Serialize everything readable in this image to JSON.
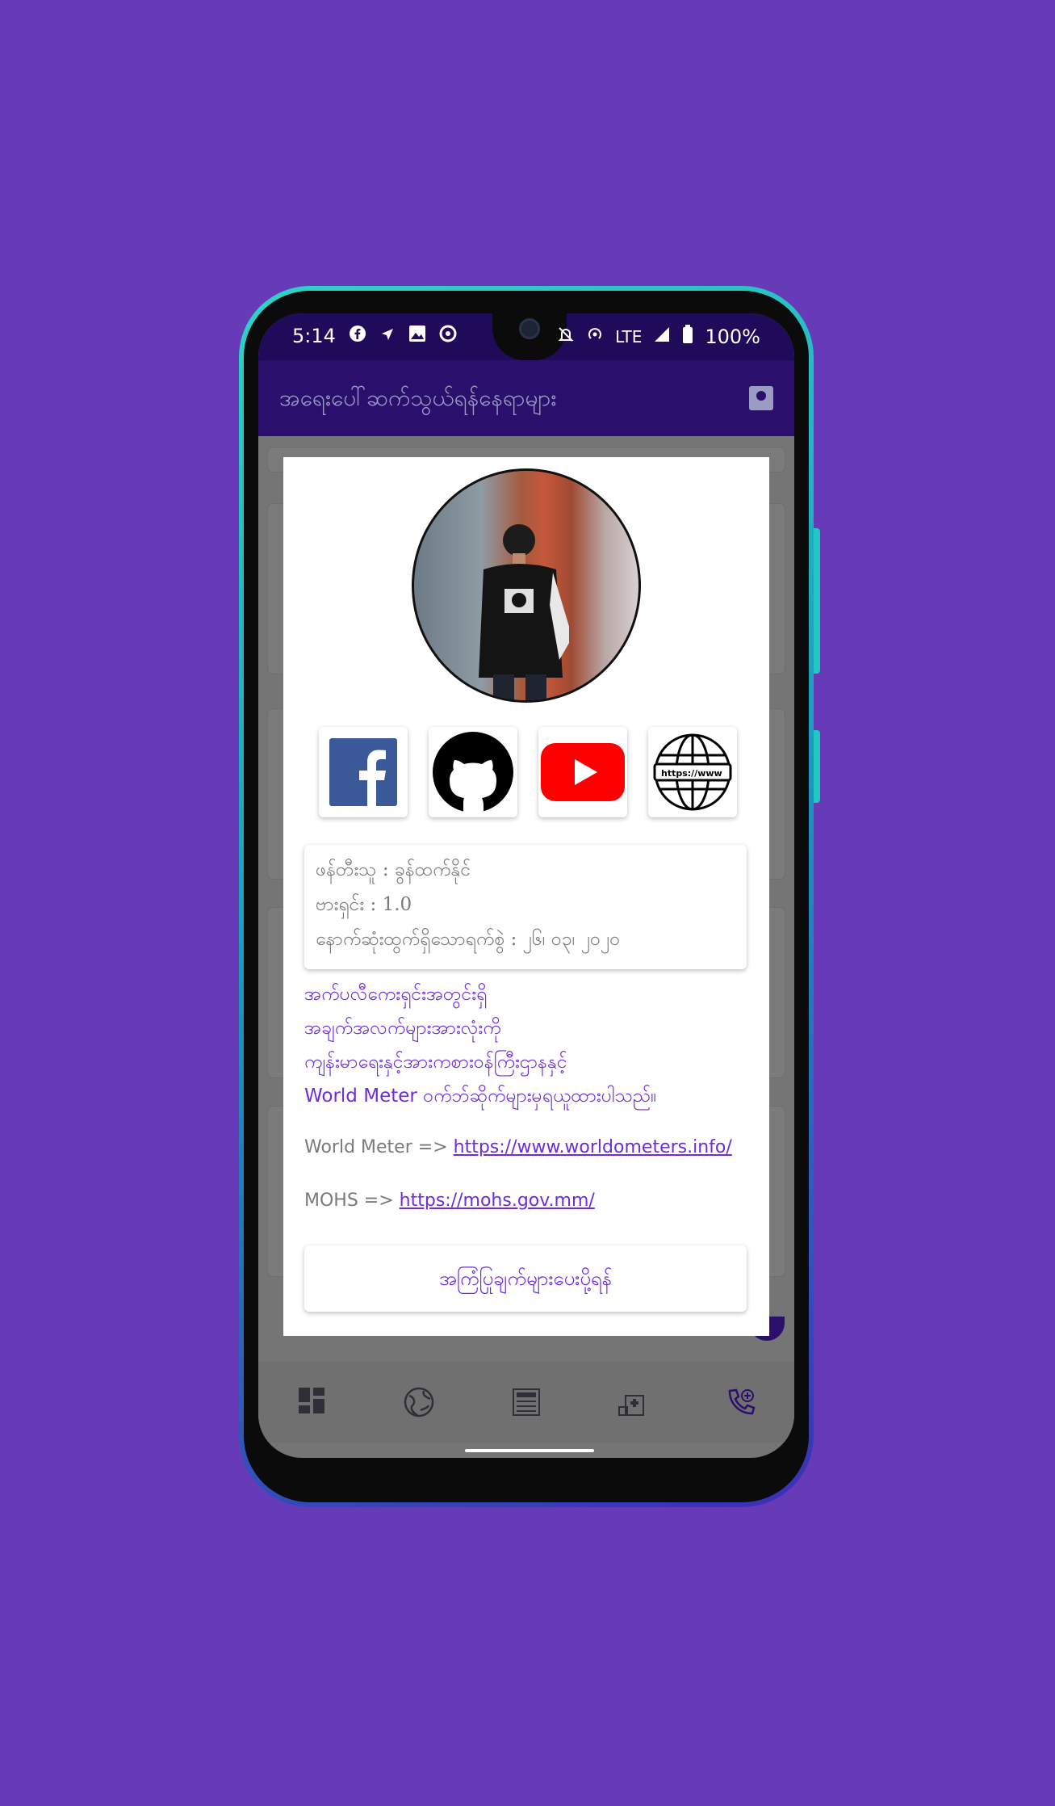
{
  "status_bar": {
    "time": "5:14",
    "network": "LTE",
    "battery": "100%"
  },
  "app_bar": {
    "title": "အရေးပေါ်ဆက်သွယ်ရန်နေရာများ",
    "action_icon": "contact-card-icon"
  },
  "dialog": {
    "social_links": [
      {
        "name": "facebook",
        "icon": "facebook-icon"
      },
      {
        "name": "github",
        "icon": "github-icon"
      },
      {
        "name": "youtube",
        "icon": "youtube-icon"
      },
      {
        "name": "website",
        "icon": "globe-icon",
        "badge_text": "https://www"
      }
    ],
    "info": {
      "developer": "ဖန်တီးသူ : ခွန်ထက်နိုင်",
      "version": "ဗားရှင်း : 1.0",
      "last_updated": "နောက်ဆုံးထွက်ရှိသောရက်စွဲ : ၂၆၊ ၀၃၊ ၂၀၂၀"
    },
    "description": [
      "အက်ပလီကေးရှင်းအတွင်းရှိ",
      "အချက်အလက်များအားလုံးကို",
      "ကျန်းမာရေးနှင့်အားကစားဝန်ကြီးဌာနနှင့်",
      "World Meter ဝက်ဘ်ဆိုက်များမှရယူထားပါသည်။"
    ],
    "sources": [
      {
        "label": "World Meter =>",
        "url": "https://www.worldometers.info/"
      },
      {
        "label": "MOHS =>",
        "url": "https://mohs.gov.mm/"
      }
    ],
    "send_button": "အကြံပြုချက်များပေးပို့ရန်"
  },
  "bottom_nav": [
    {
      "icon": "dashboard-icon"
    },
    {
      "icon": "globe-icon"
    },
    {
      "icon": "news-icon"
    },
    {
      "icon": "hospital-icon"
    },
    {
      "icon": "emergency-call-icon"
    }
  ],
  "colors": {
    "background": "#673ab7",
    "app_bar": "#2b0f6c",
    "accent": "#6f2bdc"
  }
}
